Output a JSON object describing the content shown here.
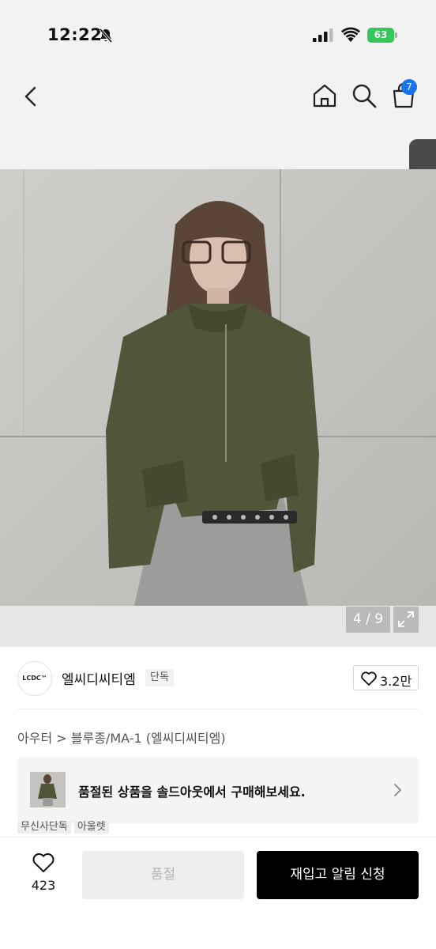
{
  "status_bar": {
    "time": "12:22",
    "battery": "63"
  },
  "nav": {
    "cart_count": "7"
  },
  "gallery": {
    "counter": "4 / 9"
  },
  "brand": {
    "logo_text": "LCDC™",
    "name": "엘씨디씨티엠",
    "tag": "단독",
    "like_count": "3.2만"
  },
  "breadcrumb": {
    "category": "아우터",
    "separator": ">",
    "subcategory": "블루종/MA-1 (엘씨디씨티엠)"
  },
  "soldout_banner": {
    "text": "품절된 상품을 솔드아웃에서 구매해보세요."
  },
  "peek_tags": [
    "무신사단독",
    "아울렛"
  ],
  "bottom_bar": {
    "wish_count": "423",
    "soldout_label": "품절",
    "restock_label": "재입고 알림 신청"
  },
  "colors": {
    "accent_blue": "#1a73e8",
    "battery_green": "#34c759",
    "primary_black": "#000000"
  },
  "icons": [
    "bell-off-icon",
    "signal-icon",
    "wifi-icon",
    "battery-icon",
    "back-chevron-icon",
    "home-icon",
    "search-icon",
    "cart-icon",
    "heart-icon",
    "expand-icon",
    "chevron-right-icon"
  ]
}
